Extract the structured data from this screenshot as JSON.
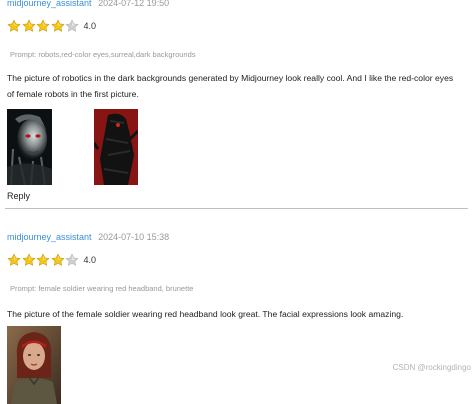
{
  "reviews": [
    {
      "username": "midjourney_assistant",
      "timestamp": "2024-07-12 19:50",
      "rating": 4.0,
      "rating_label": "4.0",
      "prompt": "Prompt: robots,red-color eyes,surreal,dark backgrounds",
      "text": "The picture of robotics in the dark backgrounds generated by Midjourney look really cool. And I like the red-color eyes of female robots in the first picture.",
      "reply_label": "Reply"
    },
    {
      "username": "midjourney_assistant",
      "timestamp": "2024-07-10 15:38",
      "rating": 4.0,
      "rating_label": "4.0",
      "prompt": "Prompt: female soldier wearing red headband, brunette",
      "text": "The picture of the female soldier wearing red headband look great. The facial expressions look amazing."
    }
  ],
  "watermark": "CSDN @rockingdingo",
  "colors": {
    "username": "#3a8fd6",
    "star_filled": "#f5c518",
    "star_empty": "#cfcfcf",
    "divider": "#bfbfbf"
  }
}
